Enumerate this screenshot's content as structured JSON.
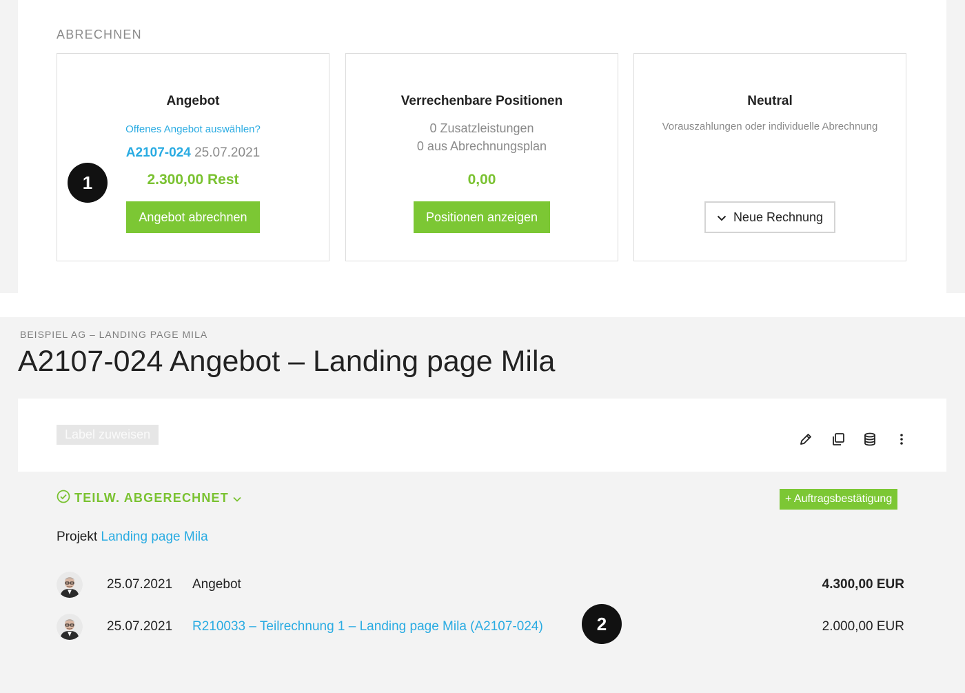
{
  "section_title": "ABRECHNEN",
  "cards": {
    "angebot": {
      "title": "Angebot",
      "select_link": "Offenes Angebot auswählen?",
      "offer_number": "A2107-024",
      "offer_date": "25.07.2021",
      "rest": "2.300,00 Rest",
      "button": "Angebot abrechnen"
    },
    "positionen": {
      "title": "Verrechenbare Positionen",
      "line1": "0 Zusatzleistungen",
      "line2": "0 aus Abrechnungsplan",
      "amount": "0,00",
      "button": "Positionen anzeigen"
    },
    "neutral": {
      "title": "Neutral",
      "description": "Vorauszahlungen oder individuelle Abrechnung",
      "button": "Neue Rechnung"
    }
  },
  "markers": [
    "1",
    "2"
  ],
  "breadcrumb": "BEISPIEL AG – LANDING PAGE MILA",
  "page_title": "A2107-024 Angebot – Landing page Mila",
  "label_button": "Label zuweisen",
  "toolbar_icons": [
    "pencil-icon",
    "copy-icon",
    "database-icon",
    "more-vertical-icon"
  ],
  "status": "TEILW. ABGERECHNET",
  "auftrag_button": "+ Auftragsbestätigung",
  "project": {
    "prefix": "Projekt",
    "link": "Landing page Mila"
  },
  "rows": [
    {
      "date": "25.07.2021",
      "description": "Angebot",
      "amount": "4.300,00 EUR"
    },
    {
      "date": "25.07.2021",
      "description": "R210033 – Teilrechnung 1 – Landing page Mila (A2107-024)",
      "amount": "2.000,00 EUR"
    }
  ],
  "colors": {
    "accent_green": "#7cc734",
    "link_blue": "#29abe2",
    "background_grey": "#f3f3f3",
    "marker_black": "#111111"
  }
}
